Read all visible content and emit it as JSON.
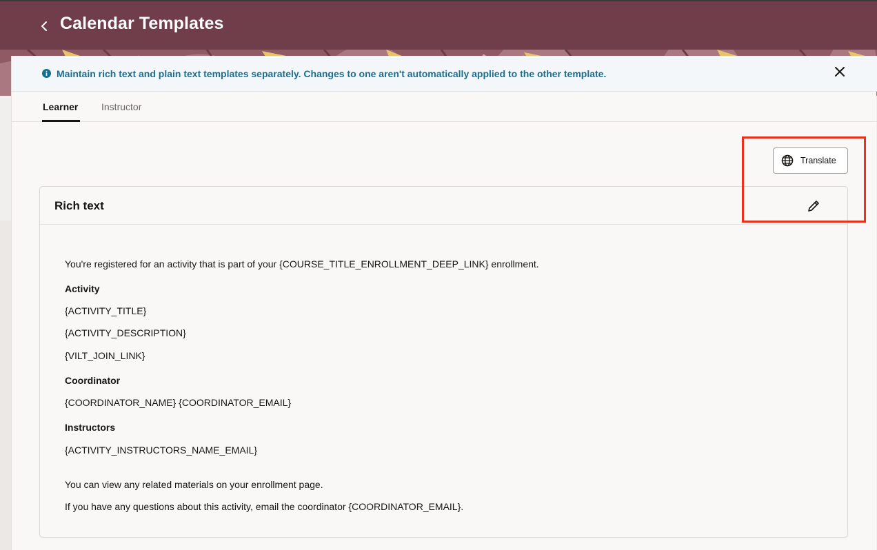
{
  "header": {
    "title": "Calendar Templates"
  },
  "banner": {
    "message": "Maintain rich text and plain text templates separately. Changes to one aren't automatically applied to the other template."
  },
  "tabs": [
    {
      "label": "Learner",
      "selected": true
    },
    {
      "label": "Instructor",
      "selected": false
    }
  ],
  "toolbar": {
    "translate_label": "Translate"
  },
  "rich_text": {
    "title": "Rich text",
    "lines": {
      "intro": "You're registered for an activity that is part of your {COURSE_TITLE_ENROLLMENT_DEEP_LINK} enrollment.",
      "activity_heading": "Activity",
      "activity_title": "{ACTIVITY_TITLE}",
      "activity_description": "{ACTIVITY_DESCRIPTION}",
      "vilt_join_link": "{VILT_JOIN_LINK}",
      "coordinator_heading": "Coordinator",
      "coordinator_info": "{COORDINATOR_NAME} {COORDINATOR_EMAIL}",
      "instructors_heading": "Instructors",
      "instructors_info": "{ACTIVITY_INSTRUCTORS_NAME_EMAIL}",
      "materials": "You can view any related materials on your enrollment page.",
      "questions": "If you have any questions about this activity, email the coordinator {COORDINATOR_EMAIL}."
    }
  },
  "colors": {
    "header_bg": "#703e4a",
    "banner_text": "#1c6e8f",
    "highlight": "#e8321e"
  }
}
